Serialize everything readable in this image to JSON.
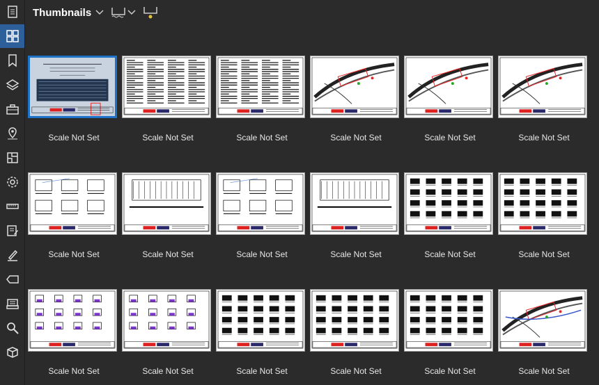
{
  "header": {
    "title": "Thumbnails"
  },
  "sidebar": {
    "items": [
      {
        "name": "file-icon",
        "active": false
      },
      {
        "name": "thumbnails-grid-icon",
        "active": true
      },
      {
        "name": "bookmarks-icon",
        "active": false
      },
      {
        "name": "layers-icon",
        "active": false
      },
      {
        "name": "toolchest-icon",
        "active": false
      },
      {
        "name": "places-icon",
        "active": false
      },
      {
        "name": "spaces-icon",
        "active": false
      },
      {
        "name": "settings-gear-icon",
        "active": false
      },
      {
        "name": "measurements-ruler-icon",
        "active": false
      },
      {
        "name": "markups-list-icon",
        "active": false
      },
      {
        "name": "signatures-pen-icon",
        "active": false
      },
      {
        "name": "tag-icon",
        "active": false
      },
      {
        "name": "scanner-icon",
        "active": false
      },
      {
        "name": "search-icon",
        "active": false
      },
      {
        "name": "3d-box-icon",
        "active": false
      }
    ]
  },
  "thumbnails": [
    {
      "label": "Scale Not Set",
      "kind": "cover",
      "selected": true
    },
    {
      "label": "Scale Not Set",
      "kind": "text",
      "selected": false
    },
    {
      "label": "Scale Not Set",
      "kind": "text",
      "selected": false
    },
    {
      "label": "Scale Not Set",
      "kind": "map",
      "selected": false
    },
    {
      "label": "Scale Not Set",
      "kind": "map",
      "selected": false
    },
    {
      "label": "Scale Not Set",
      "kind": "map",
      "selected": false
    },
    {
      "label": "Scale Not Set",
      "kind": "details",
      "selected": false
    },
    {
      "label": "Scale Not Set",
      "kind": "section",
      "selected": false
    },
    {
      "label": "Scale Not Set",
      "kind": "details",
      "selected": false
    },
    {
      "label": "Scale Not Set",
      "kind": "section",
      "selected": false
    },
    {
      "label": "Scale Not Set",
      "kind": "grid",
      "selected": false
    },
    {
      "label": "Scale Not Set",
      "kind": "grid",
      "selected": false
    },
    {
      "label": "Scale Not Set",
      "kind": "purple",
      "selected": false
    },
    {
      "label": "Scale Not Set",
      "kind": "purple",
      "selected": false
    },
    {
      "label": "Scale Not Set",
      "kind": "grid",
      "selected": false
    },
    {
      "label": "Scale Not Set",
      "kind": "grid",
      "selected": false
    },
    {
      "label": "Scale Not Set",
      "kind": "grid",
      "selected": false
    },
    {
      "label": "Scale Not Set",
      "kind": "map2",
      "selected": false
    }
  ],
  "colors": {
    "accent": "#2d5f9a",
    "selection": "#1e73c8",
    "background": "#2b2b2b"
  }
}
